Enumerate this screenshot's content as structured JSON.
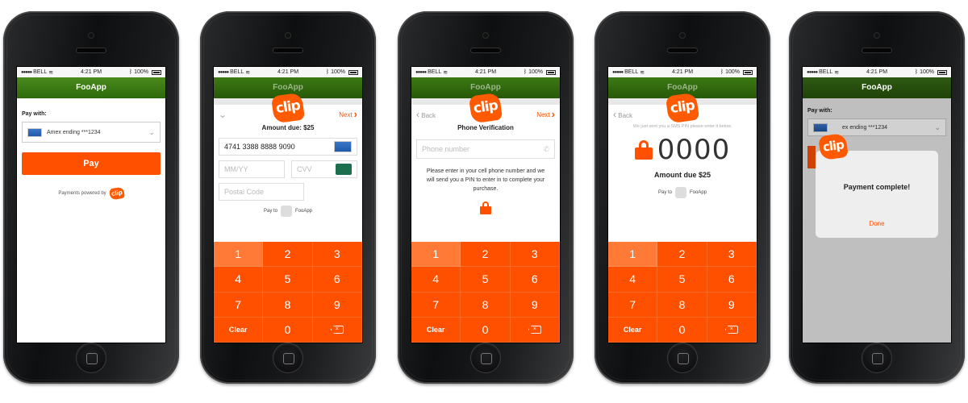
{
  "status": {
    "carrier": "BELL",
    "time": "4:21 PM",
    "battery": "100%"
  },
  "brand": {
    "clip_logo": "clip",
    "accent": "#ff5000",
    "nav_green": "#3a7a14"
  },
  "icons": [
    "wifi-icon",
    "bluetooth-icon",
    "battery-icon",
    "amex-card-icon",
    "chevron-down-icon",
    "chevron-right-icon",
    "chevron-left-icon",
    "phone-icon",
    "lock-icon",
    "backspace-icon",
    "card-cvv-icon"
  ],
  "screen1": {
    "title": "FooApp",
    "pay_with": "Pay with:",
    "card": "Amex ending ***1234",
    "pay_button": "Pay",
    "powered_by": "Payments powered by"
  },
  "screen2": {
    "title": "FooApp",
    "next": "Next",
    "amount_due": "Amount due: $25",
    "card_number": "4741  3388  8888  9090",
    "expiry_placeholder": "MM/YY",
    "cvv_placeholder": "CVV",
    "postal_placeholder": "Postal Code",
    "pay_to": "Pay to",
    "merchant": "FooApp"
  },
  "screen3": {
    "title": "FooApp",
    "back": "Back",
    "next": "Next",
    "heading": "Phone Verification",
    "phone_placeholder": "Phone number",
    "instructions": "Please enter in your cell phone number and we will send you a PIN to enter in to complete your purchase."
  },
  "screen4": {
    "title": "FooApp",
    "back": "Back",
    "sms_note": "We just sent you a SMS PIN please enter it below.",
    "pin": "0000",
    "amount_due": "Amount due $25",
    "pay_to": "Pay to",
    "merchant": "FooApp"
  },
  "screen5": {
    "title": "FooApp",
    "pay_with": "Pay with:",
    "card_partial": "ex ending ***1234",
    "modal_title": "Payment complete!",
    "modal_done": "Done"
  },
  "keypad": {
    "keys": [
      "1",
      "2",
      "3",
      "4",
      "5",
      "6",
      "7",
      "8",
      "9"
    ],
    "clear": "Clear",
    "zero": "0"
  }
}
